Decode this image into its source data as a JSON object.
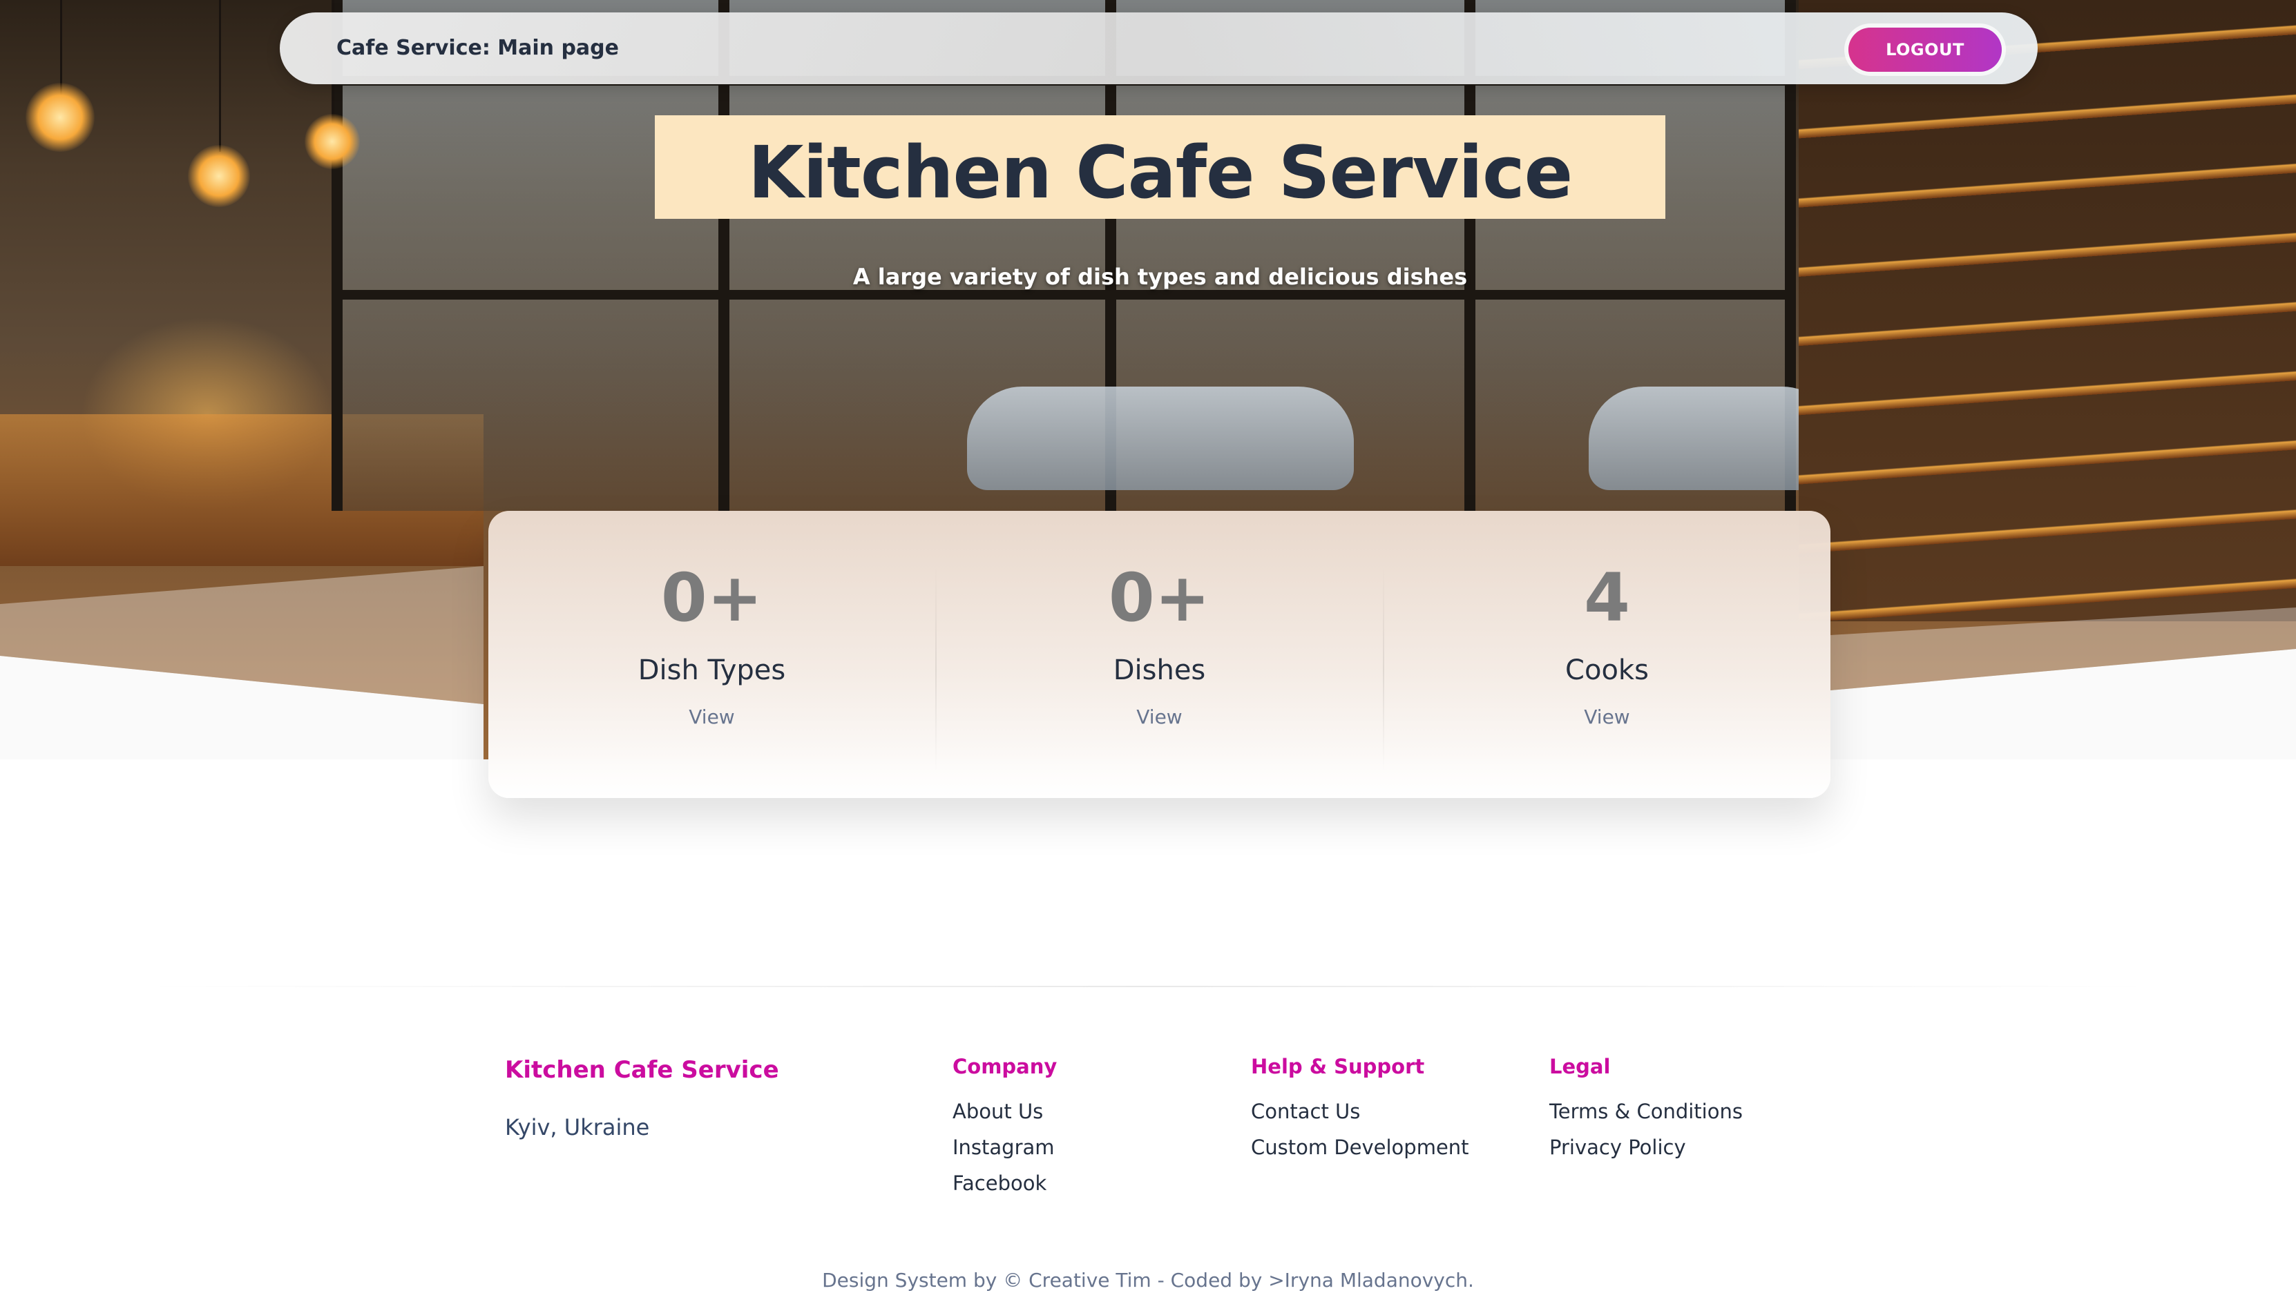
{
  "navbar": {
    "title": "Cafe Service: Main page",
    "logout_label": "LOGOUT"
  },
  "hero": {
    "headline": "Kitchen Cafe Service",
    "subtitle": "A large variety of dish types and delicious dishes"
  },
  "stats": [
    {
      "value": "0+",
      "label": "Dish Types",
      "link": "View"
    },
    {
      "value": "0+",
      "label": "Dishes",
      "link": "View"
    },
    {
      "value": "4",
      "label": "Cooks",
      "link": "View"
    }
  ],
  "footer": {
    "brand": "Kitchen Cafe Service",
    "location": "Kyiv, Ukraine",
    "columns": [
      {
        "title": "Company",
        "links": [
          "About Us",
          "Instagram",
          "Facebook"
        ]
      },
      {
        "title": "Help & Support",
        "links": [
          "Contact Us",
          "Custom Development"
        ]
      },
      {
        "title": "Legal",
        "links": [
          "Terms & Conditions",
          "Privacy Policy"
        ]
      }
    ],
    "copyright": "Design System by © Creative Tim - Coded by >Iryna Mladanovych."
  },
  "colors": {
    "accent": "#cb0c9f",
    "logout_gradient_start": "#d6338d",
    "logout_gradient_end": "#b136c6",
    "headline_box": "#fce6c0",
    "heading_text": "#252f40"
  }
}
